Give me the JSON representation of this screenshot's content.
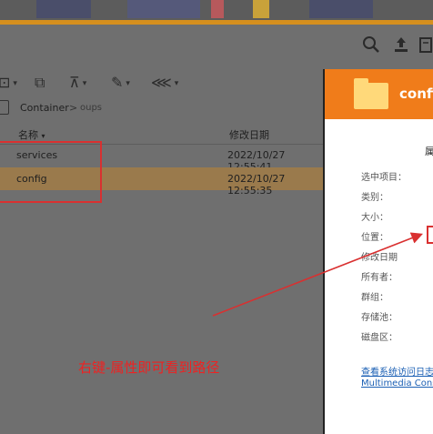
{
  "toolbar": {
    "icons": [
      "search-icon",
      "upload-icon",
      "export-icon"
    ],
    "actions": [
      "new-folder-icon",
      "copy-icon",
      "upload-arrow-icon",
      "tools-icon",
      "share-icon"
    ]
  },
  "breadcrumb": {
    "root": "Container",
    "separator": ">",
    "current": "oups"
  },
  "list": {
    "headers": {
      "name": "名称",
      "sort_indicator": "▾",
      "modified": "修改日期"
    },
    "rows": [
      {
        "name": "services",
        "modified": "2022/10/27 12:55:41"
      },
      {
        "name": "config",
        "modified": "2022/10/27 12:55:35"
      }
    ]
  },
  "properties_panel": {
    "title": "config",
    "section": "属",
    "fields": [
      "选中项目：",
      "类别：",
      "大小：",
      "位置：",
      "修改日期",
      "所有者：",
      "群组：",
      "存储池：",
      "磁盘区："
    ],
    "links": [
      "查看系统访问日志",
      "Multimedia Cons"
    ]
  },
  "annotation": "右键-属性即可看到路径",
  "colors": {
    "accent": "#f07c1a",
    "highlight_box": "#d93030",
    "selected_row": "#9a7a4c"
  }
}
